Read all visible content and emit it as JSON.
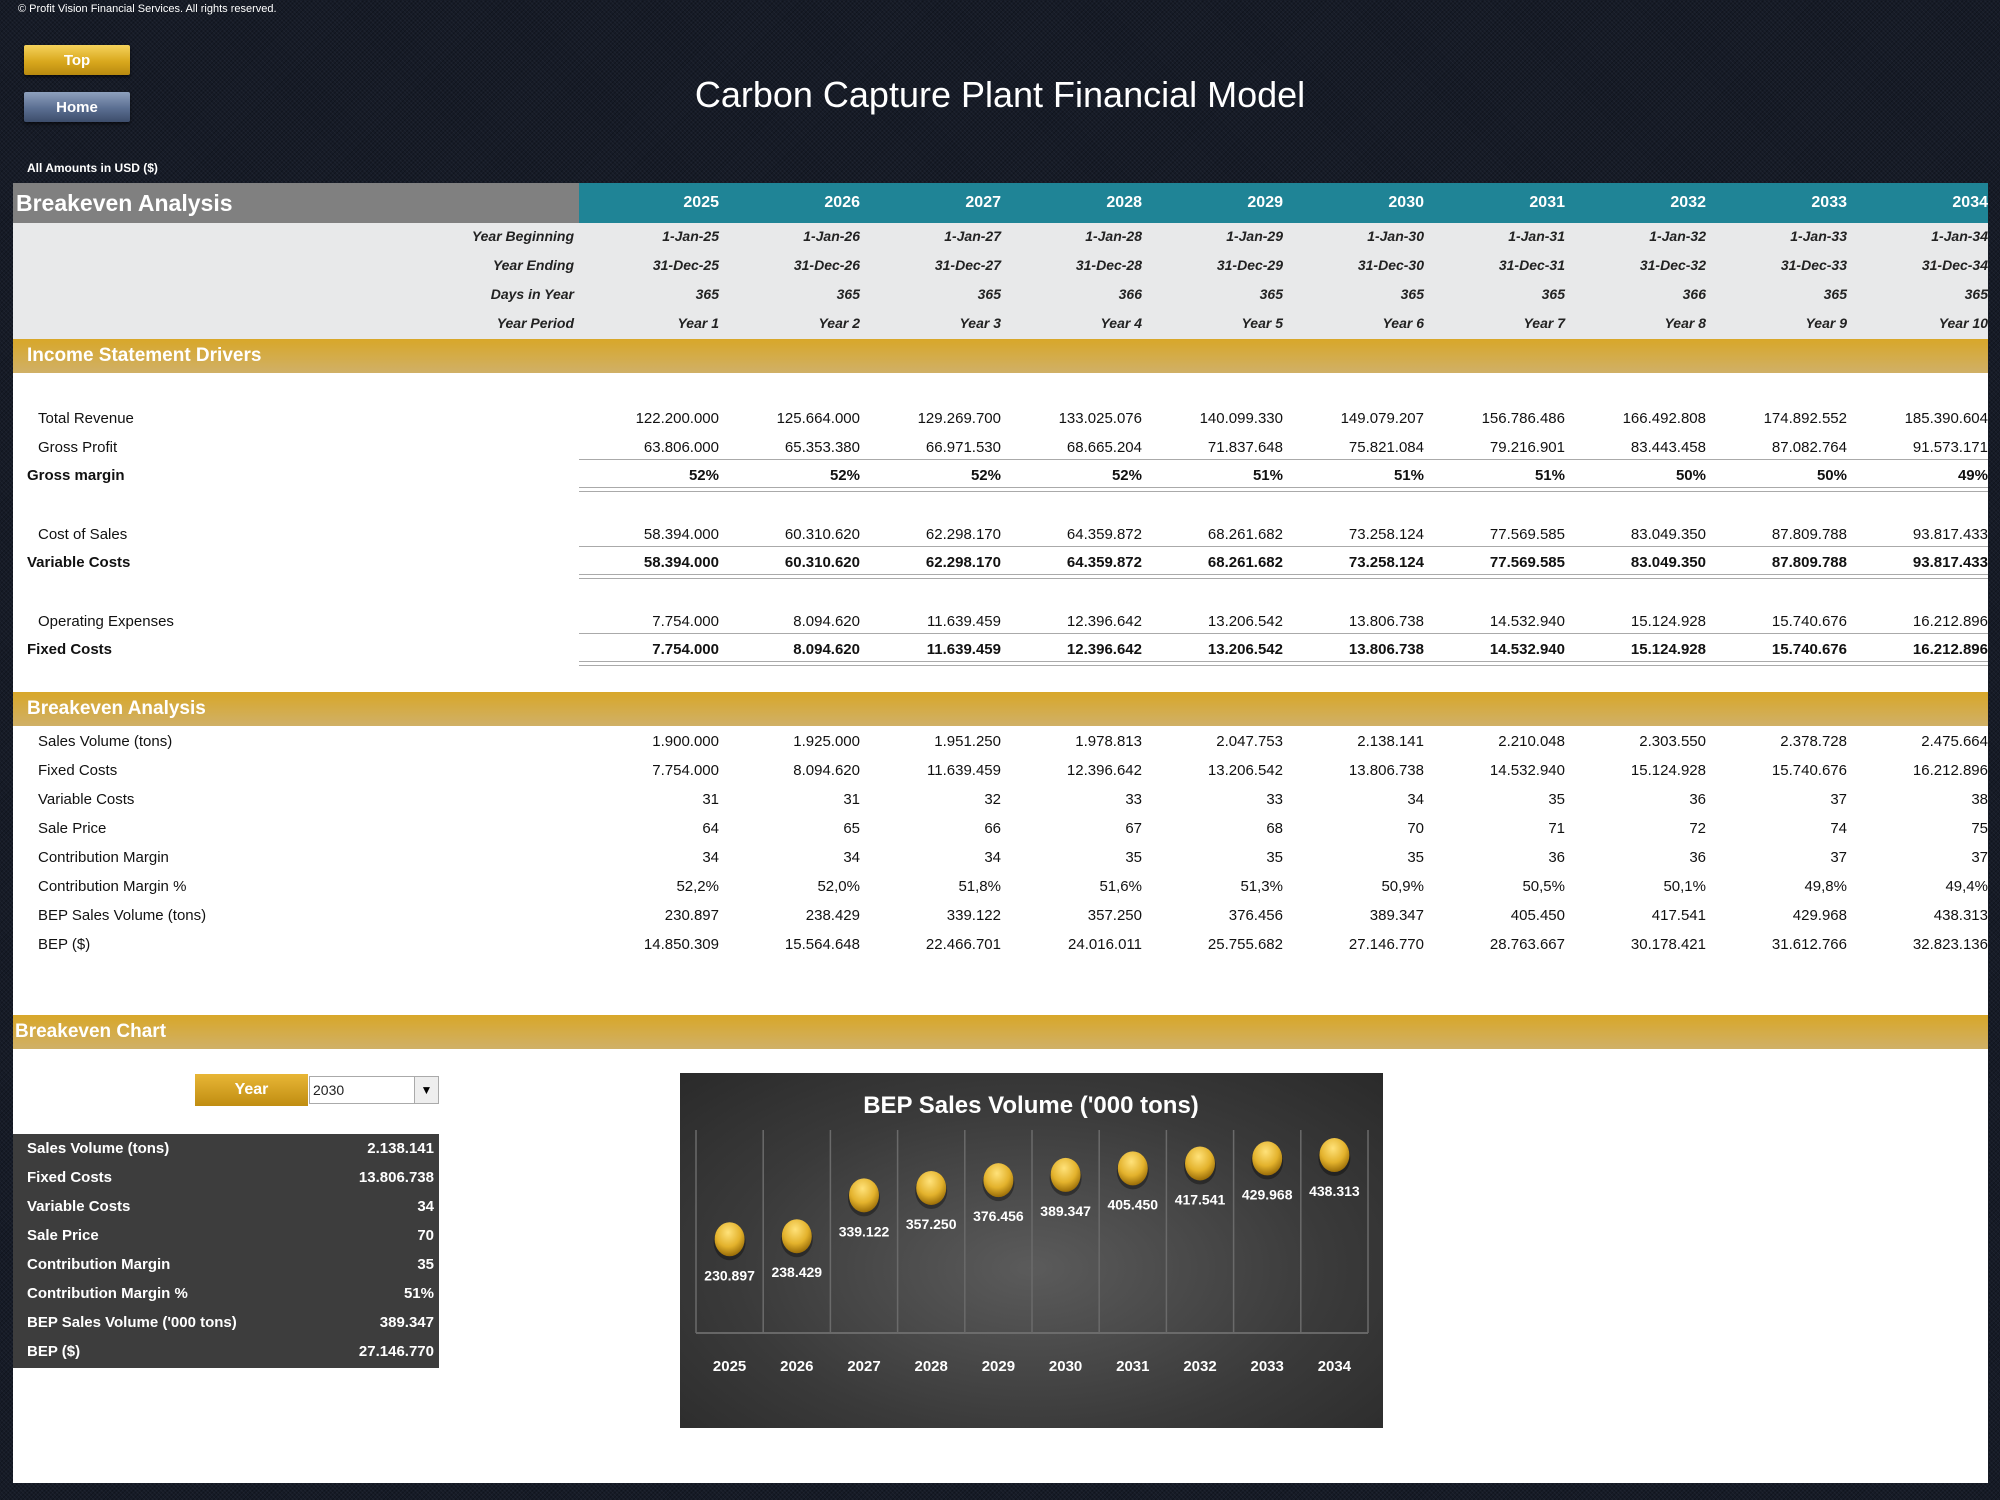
{
  "copyright": "© Profit Vision Financial Services. All rights reserved.",
  "nav": {
    "top_label": "Top",
    "home_label": "Home"
  },
  "page_title": "Carbon Capture Plant Financial Model",
  "amounts_note": "All Amounts in  USD ($)",
  "header": {
    "title": "Breakeven Analysis",
    "years": [
      "2025",
      "2026",
      "2027",
      "2028",
      "2029",
      "2030",
      "2031",
      "2032",
      "2033",
      "2034"
    ]
  },
  "meta_rows": [
    {
      "label": "Year Beginning",
      "values": [
        "1-Jan-25",
        "1-Jan-26",
        "1-Jan-27",
        "1-Jan-28",
        "1-Jan-29",
        "1-Jan-30",
        "1-Jan-31",
        "1-Jan-32",
        "1-Jan-33",
        "1-Jan-34"
      ]
    },
    {
      "label": "Year Ending",
      "values": [
        "31-Dec-25",
        "31-Dec-26",
        "31-Dec-27",
        "31-Dec-28",
        "31-Dec-29",
        "31-Dec-30",
        "31-Dec-31",
        "31-Dec-32",
        "31-Dec-33",
        "31-Dec-34"
      ]
    },
    {
      "label": "Days in Year",
      "values": [
        "365",
        "365",
        "365",
        "366",
        "365",
        "365",
        "365",
        "366",
        "365",
        "365"
      ]
    },
    {
      "label": "Year Period",
      "values": [
        "Year 1",
        "Year 2",
        "Year 3",
        "Year 4",
        "Year 5",
        "Year 6",
        "Year 7",
        "Year 8",
        "Year 9",
        "Year 10"
      ]
    }
  ],
  "income_section": {
    "title": "Income Statement Drivers",
    "rows": [
      {
        "label": "Total Revenue",
        "bold": false,
        "values": [
          "122.200.000",
          "125.664.000",
          "129.269.700",
          "133.025.076",
          "140.099.330",
          "149.079.207",
          "156.786.486",
          "166.492.808",
          "174.892.552",
          "185.390.604"
        ]
      },
      {
        "label": "Gross Profit",
        "bold": false,
        "values": [
          "63.806.000",
          "65.353.380",
          "66.971.530",
          "68.665.204",
          "71.837.648",
          "75.821.084",
          "79.216.901",
          "83.443.458",
          "87.082.764",
          "91.573.171"
        ]
      },
      {
        "label": "Gross margin",
        "bold": true,
        "values": [
          "52%",
          "52%",
          "52%",
          "52%",
          "51%",
          "51%",
          "51%",
          "50%",
          "50%",
          "49%"
        ]
      },
      {
        "label": "Cost of Sales",
        "bold": false,
        "values": [
          "58.394.000",
          "60.310.620",
          "62.298.170",
          "64.359.872",
          "68.261.682",
          "73.258.124",
          "77.569.585",
          "83.049.350",
          "87.809.788",
          "93.817.433"
        ]
      },
      {
        "label": "Variable Costs",
        "bold": true,
        "values": [
          "58.394.000",
          "60.310.620",
          "62.298.170",
          "64.359.872",
          "68.261.682",
          "73.258.124",
          "77.569.585",
          "83.049.350",
          "87.809.788",
          "93.817.433"
        ]
      },
      {
        "label": "Operating Expenses",
        "bold": false,
        "values": [
          "7.754.000",
          "8.094.620",
          "11.639.459",
          "12.396.642",
          "13.206.542",
          "13.806.738",
          "14.532.940",
          "15.124.928",
          "15.740.676",
          "16.212.896"
        ]
      },
      {
        "label": "Fixed Costs",
        "bold": true,
        "values": [
          "7.754.000",
          "8.094.620",
          "11.639.459",
          "12.396.642",
          "13.206.542",
          "13.806.738",
          "14.532.940",
          "15.124.928",
          "15.740.676",
          "16.212.896"
        ]
      }
    ]
  },
  "breakeven_section": {
    "title": "Breakeven Analysis",
    "rows": [
      {
        "label": "Sales Volume (tons)",
        "values": [
          "1.900.000",
          "1.925.000",
          "1.951.250",
          "1.978.813",
          "2.047.753",
          "2.138.141",
          "2.210.048",
          "2.303.550",
          "2.378.728",
          "2.475.664"
        ]
      },
      {
        "label": "Fixed Costs",
        "values": [
          "7.754.000",
          "8.094.620",
          "11.639.459",
          "12.396.642",
          "13.206.542",
          "13.806.738",
          "14.532.940",
          "15.124.928",
          "15.740.676",
          "16.212.896"
        ]
      },
      {
        "label": "Variable Costs",
        "values": [
          "31",
          "31",
          "32",
          "33",
          "33",
          "34",
          "35",
          "36",
          "37",
          "38"
        ]
      },
      {
        "label": "Sale Price",
        "values": [
          "64",
          "65",
          "66",
          "67",
          "68",
          "70",
          "71",
          "72",
          "74",
          "75"
        ]
      },
      {
        "label": "Contribution Margin",
        "values": [
          "34",
          "34",
          "34",
          "35",
          "35",
          "35",
          "36",
          "36",
          "37",
          "37"
        ]
      },
      {
        "label": "Contribution Margin %",
        "values": [
          "52,2%",
          "52,0%",
          "51,8%",
          "51,6%",
          "51,3%",
          "50,9%",
          "50,5%",
          "50,1%",
          "49,8%",
          "49,4%"
        ]
      },
      {
        "label": "BEP Sales Volume (tons)",
        "values": [
          "230.897",
          "238.429",
          "339.122",
          "357.250",
          "376.456",
          "389.347",
          "405.450",
          "417.541",
          "429.968",
          "438.313"
        ]
      },
      {
        "label": "BEP ($)",
        "values": [
          "14.850.309",
          "15.564.648",
          "22.466.701",
          "24.016.011",
          "25.755.682",
          "27.146.770",
          "28.763.667",
          "30.178.421",
          "31.612.766",
          "32.823.136"
        ]
      }
    ]
  },
  "chart_section": {
    "title": "Breakeven Chart",
    "year_label": "Year",
    "year_selected": "2030",
    "dropdown_icon": "triangle-down",
    "summary": [
      {
        "label": "Sales Volume (tons)",
        "value": "2.138.141"
      },
      {
        "label": "Fixed Costs",
        "value": "13.806.738"
      },
      {
        "label": "Variable Costs",
        "value": "34"
      },
      {
        "label": "Sale Price",
        "value": "70"
      },
      {
        "label": "Contribution Margin",
        "value": "35"
      },
      {
        "label": "Contribution Margin %",
        "value": "51%"
      },
      {
        "label": "BEP Sales Volume ('000 tons)",
        "value": "389.347"
      },
      {
        "label": "BEP ($)",
        "value": "27.146.770"
      }
    ]
  },
  "colors": {
    "header_teal": "#1f8496",
    "header_gray": "#808080",
    "band_gold": "#d8a729",
    "marker_gold": "#e3b22c",
    "summary_bg": "#3d3d3d"
  },
  "chart_data": {
    "type": "scatter",
    "title": "BEP Sales Volume ('000 tons)",
    "categories": [
      "2025",
      "2026",
      "2027",
      "2028",
      "2029",
      "2030",
      "2031",
      "2032",
      "2033",
      "2034"
    ],
    "values": [
      230.897,
      238.429,
      339.122,
      357.25,
      376.456,
      389.347,
      405.45,
      417.541,
      429.968,
      438.313
    ],
    "data_labels": [
      "230.897",
      "238.429",
      "339.122",
      "357.250",
      "376.456",
      "389.347",
      "405.450",
      "417.541",
      "429.968",
      "438.313"
    ],
    "xlabel": "",
    "ylabel": "",
    "ylim": [
      0,
      500
    ],
    "grid": "vertical",
    "legend": "none"
  }
}
